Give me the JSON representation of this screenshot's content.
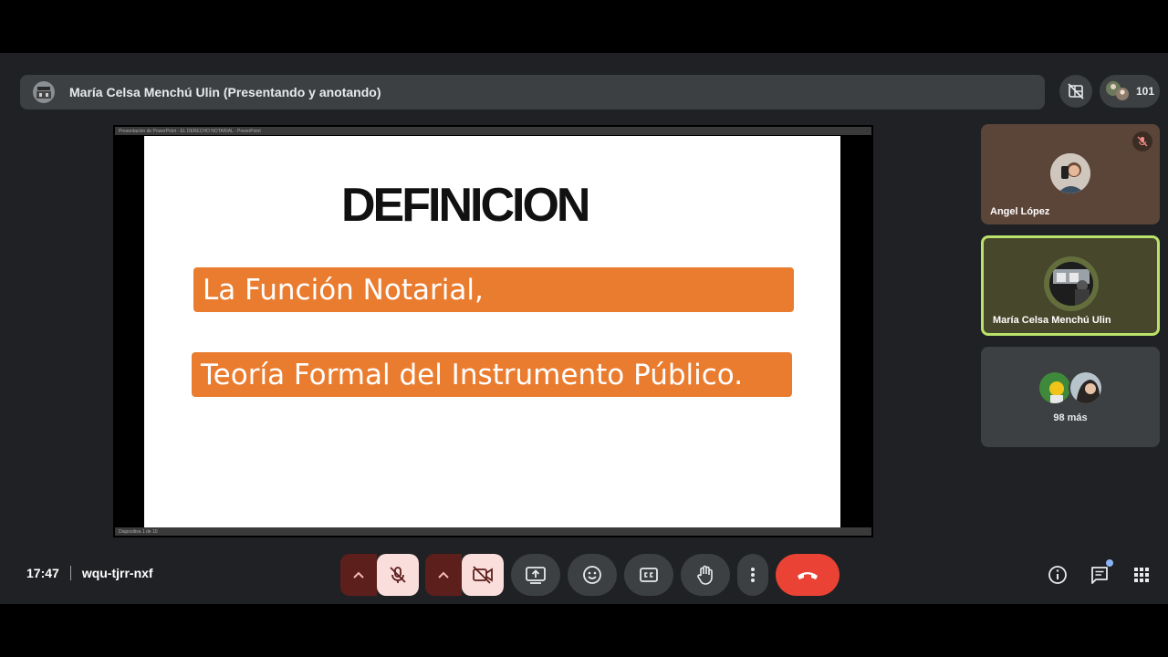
{
  "presenter": {
    "label": "María Celsa Menchú Ulin (Presentando y anotando)"
  },
  "people": {
    "count": "101"
  },
  "share": {
    "titlebar": "Presentación de PowerPoint - EL DERECHO NOTARIAL - PowerPoint",
    "statusbar": "Diapositiva 1 de 10"
  },
  "slide": {
    "title": "DEFINICION",
    "items": [
      "La Función Notarial,",
      "Teoría Formal del Instrumento Público."
    ],
    "accent_color": "#ea7c30"
  },
  "tiles": [
    {
      "name": "Angel López",
      "muted": true
    },
    {
      "name": "María Celsa Menchú Ulin",
      "speaking": true,
      "highlight_color": "#b9e36a"
    },
    {
      "more_label": "98 más"
    }
  ],
  "meeting": {
    "time": "17:47",
    "code": "wqu-tjrr-nxf"
  },
  "controls": {
    "mic": "mic-off",
    "camera": "camera-off",
    "end_call_color": "#ea4335"
  }
}
